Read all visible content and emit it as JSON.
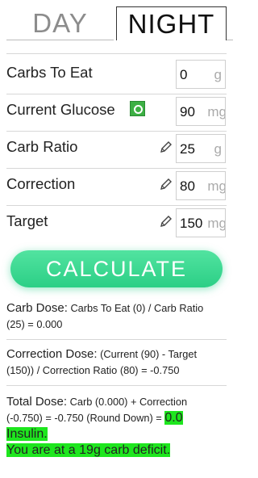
{
  "tabs": {
    "day": "DAY",
    "night": "NIGHT"
  },
  "rows": {
    "carbs": {
      "label": "Carbs To Eat",
      "value": "0",
      "unit": "g"
    },
    "glucose": {
      "label": "Current Glucose",
      "value": "90",
      "unit": "mg"
    },
    "ratio": {
      "label": "Carb Ratio",
      "value": "25",
      "unit": "g"
    },
    "correction": {
      "label": "Correction",
      "value": "80",
      "unit": "mg"
    },
    "target": {
      "label": "Target",
      "value": "150",
      "unit": "mg"
    }
  },
  "calculate_label": "CALCULATE",
  "results": {
    "carb_dose_label": "Carb Dose:",
    "carb_dose_text": "Carbs To Eat (0) / Carb Ratio (25) = 0.000",
    "correction_label": "Correction Dose:",
    "correction_text": "(Current (90) - Target (150)) / Correction Ratio (80) = -0.750",
    "total_label": "Total Dose:",
    "total_text": "Carb (0.000) + Correction (-0.750) = -0.750 (Round Down) =",
    "total_value": "0.0",
    "insulin": "Insulin.",
    "deficit": "You are at a 19g carb deficit."
  },
  "colors": {
    "accent": "#2bcf86",
    "highlight": "#1ee61e",
    "badge": "#3cb043"
  },
  "icons": {
    "glucose_badge": "glucose-sync-icon",
    "edit": "pencil-icon"
  }
}
